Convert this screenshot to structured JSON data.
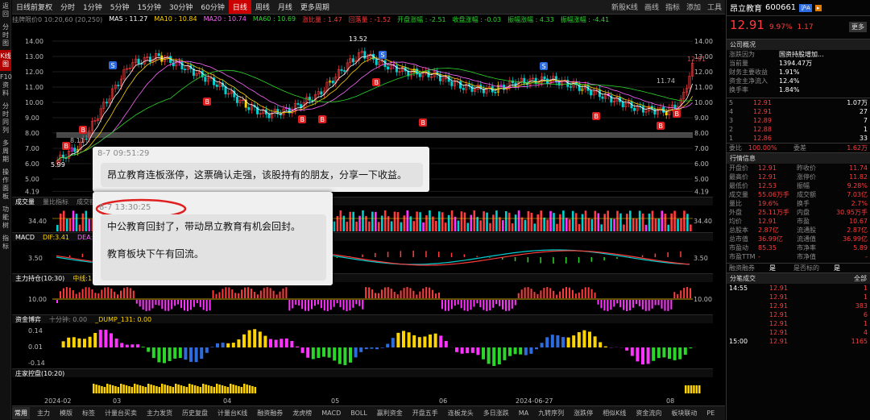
{
  "left_sidebar": [
    "返回",
    "分时图",
    "K线图",
    "F10资料",
    "分时同列",
    "多周期",
    "操作面板",
    "功能树",
    "指标"
  ],
  "toolbar": {
    "left_label": "日线前复权",
    "periods": [
      "分时",
      "1分钟",
      "5分钟",
      "15分钟",
      "30分钟",
      "60分钟",
      "日线",
      "周线",
      "月线",
      "更多周期"
    ],
    "active_period": "日线",
    "right_items": [
      "新股K线",
      "画线",
      "指标",
      "添加",
      "工具"
    ]
  },
  "ma_row": {
    "date": "挂牌限价0 10:20,60 (20,250)",
    "ma5": "MA5 : 11.27",
    "ma10": "MA10 : 10.84",
    "ma20": "MA20 : 10.74",
    "ma60": "MA60 : 10.69",
    "ind1": "涨比量 : 1.47",
    "ind2": "回落量 : -1.52",
    "ind3": "开盘涨幅 : -2.51",
    "ind4": "收盘涨幅 : -0.03",
    "ind5": "振幅涨幅 : 4.33",
    "ind6": "振幅涨幅 : -4.41"
  },
  "main_chart": {
    "y_ticks": [
      "14.00",
      "13.00",
      "12.00",
      "11.00",
      "10.00",
      "9.00",
      "8.00",
      "7.00",
      "6.00",
      "5.00",
      "4.19"
    ],
    "left_low": "5.99",
    "left_low2": "8.11",
    "peak_label": "13.52",
    "right_labels": [
      "12.91",
      "11.74"
    ],
    "b_marker": "B",
    "s_marker": "S"
  },
  "panels": {
    "vol_header": [
      "成交量",
      "量比指标",
      "成交额"
    ],
    "vol_value": "34.40",
    "macd_header": [
      "MACD",
      "DIF:3.41",
      "DEA:3.2"
    ],
    "macd_value": "3.50",
    "kdj_header": [
      "主力持仓(10:30)",
      "中线:11.81"
    ],
    "kdj_value": "10.00",
    "sub_header": [
      "资金博弈",
      "十分钟: 0.00",
      "_DUMP_131: 0.00"
    ],
    "sub_values": [
      "0.14",
      "0.01",
      "-0.14"
    ],
    "last_header": [
      "庄家控盘(10:20)"
    ],
    "x_labels": [
      "2024-02",
      "03",
      "04",
      "05",
      "06",
      "2024-06-27",
      "08"
    ]
  },
  "popup1": {
    "time": "8-7 09:51:29",
    "text": "昂立教育连板涨停，这票确认走强，该股持有的朋友，分享一下收益。"
  },
  "popup2": {
    "time": "8-7 13:30:25",
    "text1": "中公教育回封了，带动昂立教育有机会回封。",
    "text2": "教育板块下午有回流。"
  },
  "bottom_tabs": [
    "常用",
    "主力",
    "模版",
    "标签",
    "计量台买卖",
    "主力发货",
    "历史复盘",
    "计量台K线",
    "融资融券",
    "龙虎榜",
    "MACD",
    "BOLL",
    "赢利资金",
    "开盘五手",
    "连板龙头",
    "多日涨跌",
    "MA",
    "九转序列",
    "涨跌停",
    "相似K线",
    "资金流向",
    "板块联动",
    "PE",
    "更多"
  ],
  "active_bottom_tab": "常用",
  "right_panel": {
    "stock_name": "昂立教育",
    "stock_code": "600661",
    "price": "12.91",
    "change_pct": "9.97%",
    "change": "1.17",
    "info_header": "公司概况",
    "info_rows": [
      [
        "涨跌因为",
        "国资持股增加..."
      ],
      [
        "当前量",
        "1394.47万"
      ],
      [
        "财务主要收益",
        "1.91%"
      ],
      [
        "资金主净流入",
        "12.4%"
      ],
      [
        "换手率",
        "1.84%"
      ]
    ],
    "sell_orders": [
      [
        "5",
        "12.91",
        "1.07万"
      ],
      [
        "4",
        "12.91",
        "27"
      ],
      [
        "3",
        "12.89",
        "7"
      ],
      [
        "2",
        "12.88",
        "1"
      ],
      [
        "1",
        "12.86",
        "33"
      ]
    ],
    "order_diff": [
      "委比",
      "100.00%",
      "委差",
      "1.62万"
    ],
    "quote_header": "行情信息",
    "quote_rows": [
      [
        "开盘价",
        "12.91",
        "昨收价",
        "11.74"
      ],
      [
        "最高价",
        "12.91",
        "涨停价",
        "11.82"
      ],
      [
        "最低价",
        "12.53",
        "振幅",
        "9.28%"
      ],
      [
        "成交量",
        "55.06万手",
        "成交额",
        "7.03亿"
      ],
      [
        "量比",
        "19.6%",
        "换手",
        "2.7%"
      ],
      [
        "外盘",
        "25.11万手",
        "内盘",
        "30.95万手"
      ],
      [
        "均价",
        "12.91",
        "市盈",
        "10.67"
      ],
      [
        "总股本",
        "2.87亿",
        "流通股",
        "2.87亿"
      ],
      [
        "总市值",
        "36.99亿",
        "流通值",
        "36.99亿"
      ],
      [
        "市盈动",
        "85.35",
        "市净率",
        "5.89"
      ],
      [
        "市盈TTM",
        "-",
        "市净值",
        "-"
      ]
    ],
    "margin_row": [
      "融资融券",
      "是",
      "是否标的",
      "是"
    ],
    "tick_header": "分笔成交",
    "tick_tab": "全部",
    "ticks": [
      [
        "14:55",
        "12.91",
        "1"
      ],
      [
        "",
        "12.91",
        "1"
      ],
      [
        "",
        "12.91",
        "383"
      ],
      [
        "",
        "12.91",
        "6"
      ],
      [
        "",
        "12.91",
        "1"
      ],
      [
        "",
        "12.91",
        "4"
      ],
      [
        "15:00",
        "12.91",
        "1165"
      ]
    ]
  }
}
